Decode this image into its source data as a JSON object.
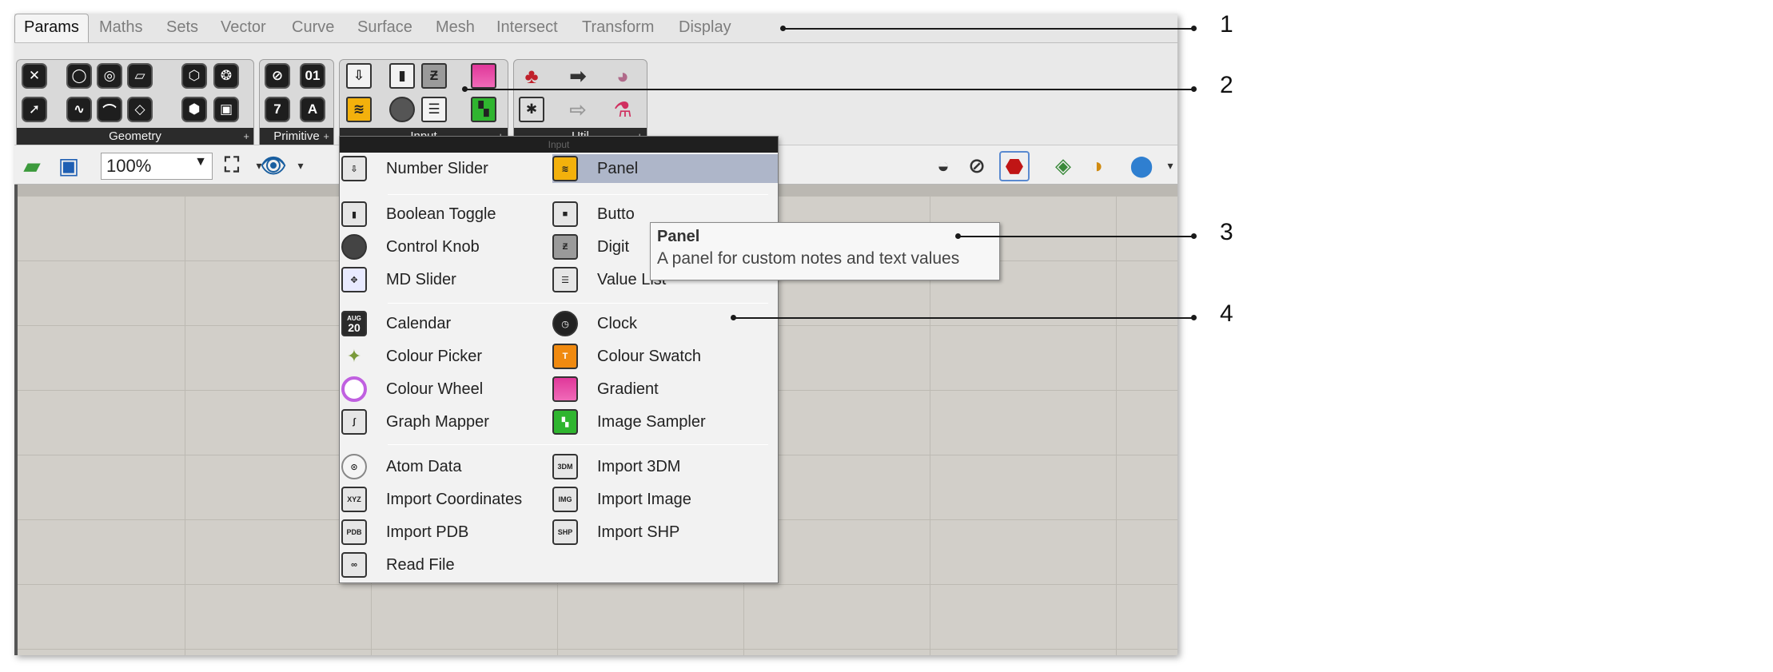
{
  "tabs": [
    "Params",
    "Maths",
    "Sets",
    "Vector",
    "Curve",
    "Surface",
    "Mesh",
    "Intersect",
    "Transform",
    "Display"
  ],
  "ribbon": {
    "panels": [
      {
        "label": "Geometry"
      },
      {
        "label": "Primitive"
      },
      {
        "label": "Input"
      },
      {
        "label": "Util"
      }
    ]
  },
  "toolbar": {
    "zoom": "100%"
  },
  "menu": {
    "header": "Input",
    "items": [
      {
        "label": "Number Slider",
        "icon": "number-slider-icon"
      },
      {
        "label": "Panel",
        "icon": "panel-icon"
      },
      {
        "label": "Boolean Toggle",
        "icon": "boolean-toggle-icon"
      },
      {
        "label": "Butto",
        "icon": "button-icon"
      },
      {
        "label": "Control Knob",
        "icon": "control-knob-icon"
      },
      {
        "label": "Digit",
        "icon": "digit-scroller-icon"
      },
      {
        "label": "MD Slider",
        "icon": "md-slider-icon"
      },
      {
        "label": "Value List",
        "icon": "value-list-icon"
      },
      {
        "label": "Calendar",
        "icon": "calendar-icon"
      },
      {
        "label": "Clock",
        "icon": "clock-icon"
      },
      {
        "label": "Colour Picker",
        "icon": "colour-picker-icon"
      },
      {
        "label": "Colour Swatch",
        "icon": "colour-swatch-icon"
      },
      {
        "label": "Colour Wheel",
        "icon": "colour-wheel-icon"
      },
      {
        "label": "Gradient",
        "icon": "gradient-icon"
      },
      {
        "label": "Graph Mapper",
        "icon": "graph-mapper-icon"
      },
      {
        "label": "Image Sampler",
        "icon": "image-sampler-icon"
      },
      {
        "label": "Atom Data",
        "icon": "atom-data-icon"
      },
      {
        "label": "Import 3DM",
        "icon": "import-3dm-icon"
      },
      {
        "label": "Import Coordinates",
        "icon": "import-coordinates-icon"
      },
      {
        "label": "Import Image",
        "icon": "import-image-icon"
      },
      {
        "label": "Import PDB",
        "icon": "import-pdb-icon"
      },
      {
        "label": "Import SHP",
        "icon": "import-shp-icon"
      },
      {
        "label": "Read File",
        "icon": "read-file-icon"
      }
    ],
    "icon_text": {
      "calendar_month": "AUG",
      "calendar_day": "20",
      "xyz": "XYZ",
      "dm3": "3DM",
      "img": "IMG",
      "pdb": "PDB",
      "shp": "SHP"
    }
  },
  "tooltip": {
    "title": "Panel",
    "description": "A panel for custom notes and text values"
  },
  "callouts": [
    "1",
    "2",
    "3",
    "4"
  ],
  "colors": {
    "menu_highlight": "#aeb6c9",
    "canvas": "#d2cfc9",
    "panel_label_bg": "#2b2b2b"
  }
}
